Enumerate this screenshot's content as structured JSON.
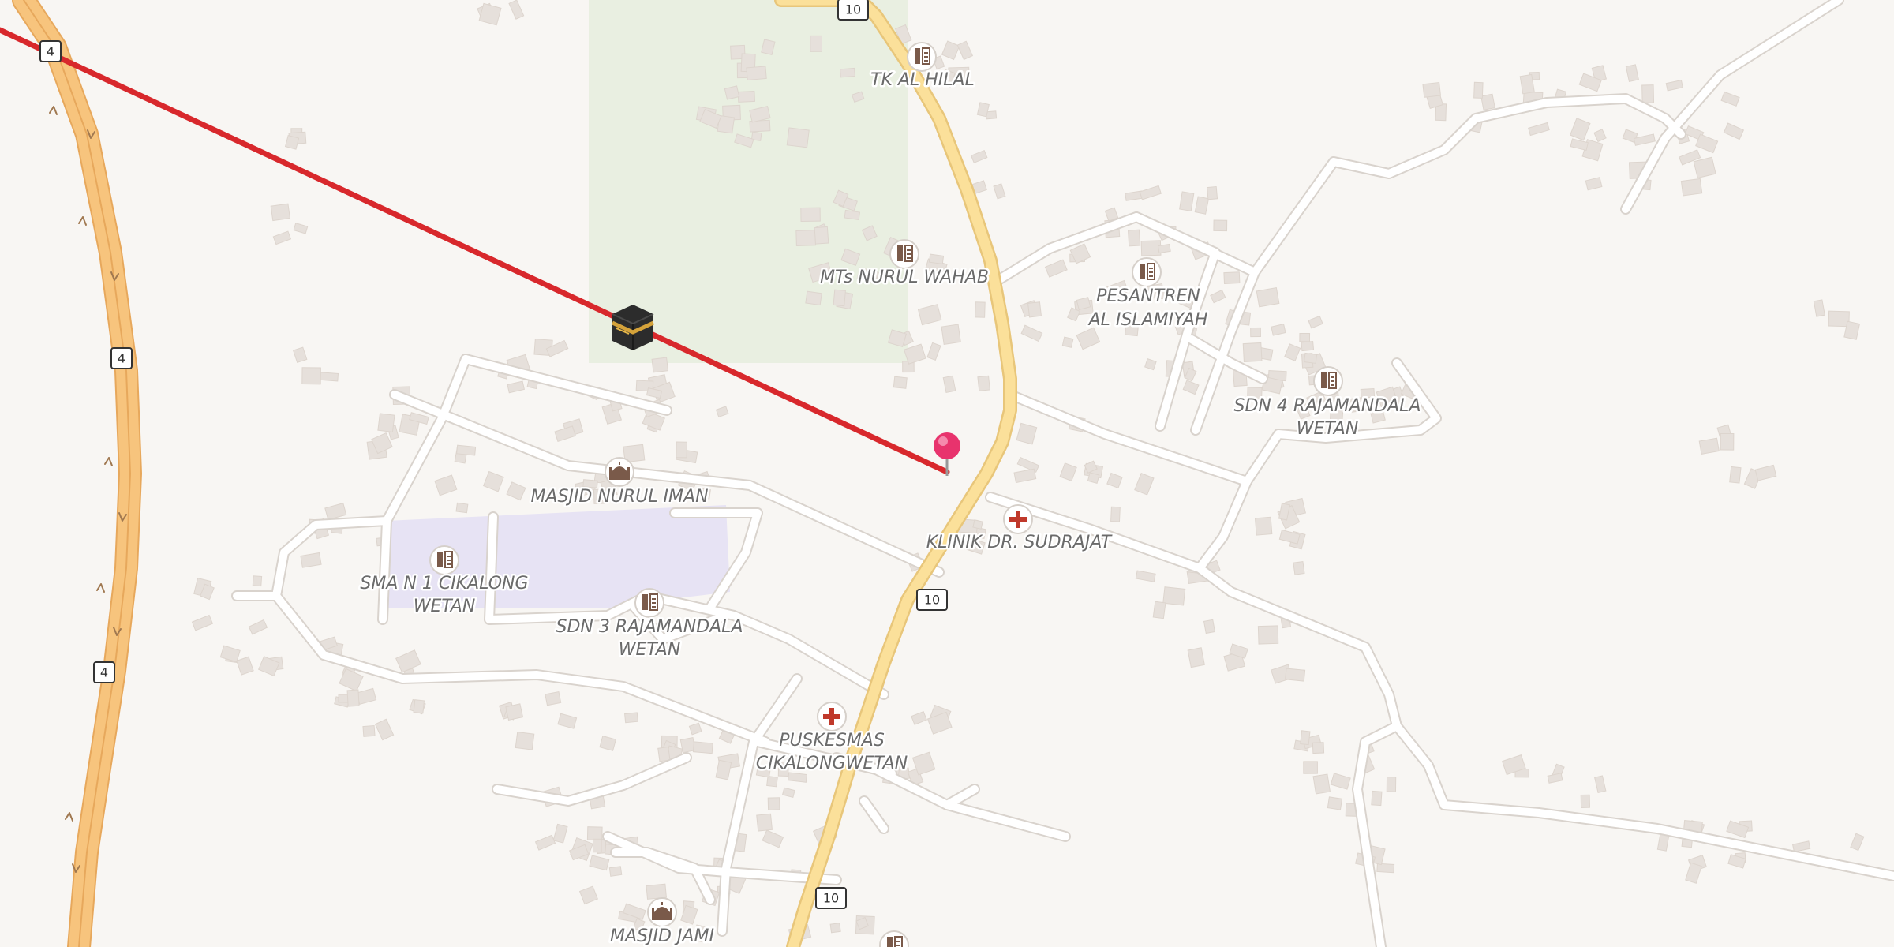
{
  "map": {
    "colors": {
      "background": "#f8f6f3",
      "park": "#e9efe1",
      "school": "#e7e3f4",
      "building": "#e6e0db",
      "road": "#ffffff",
      "main_road": "#fbe09a",
      "trunk_road": "#f7c47d",
      "qibla_line": "#d8282c",
      "pin": "#e8336d",
      "poi_icon": "#7a5a4a",
      "health_icon": "#c0392b"
    },
    "route_shields": [
      "4",
      "4",
      "4",
      "10",
      "10",
      "10"
    ],
    "poi_labels": [
      {
        "text": "TK AL HILAL",
        "icon": "school-icon"
      },
      {
        "text": "MTs NURUL WAHAB",
        "icon": "school-icon"
      },
      {
        "text": "PESANTREN",
        "icon": "school-icon"
      },
      {
        "text": "AL ISLAMIYAH",
        "icon": "none"
      },
      {
        "text": "SDN 4 RAJAMANDALA",
        "icon": "school-icon"
      },
      {
        "text": "WETAN",
        "icon": "none"
      },
      {
        "text": "MASJID NURUL IMAN",
        "icon": "mosque-icon"
      },
      {
        "text": "KLINIK DR. SUDRAJAT",
        "icon": "health-icon"
      },
      {
        "text": "SMA N 1 CIKALONG",
        "icon": "school-icon"
      },
      {
        "text": "WETAN",
        "icon": "none"
      },
      {
        "text": "SDN 3 RAJAMANDALA",
        "icon": "school-icon"
      },
      {
        "text": "WETAN",
        "icon": "none"
      },
      {
        "text": "PUSKESMAS",
        "icon": "health-icon"
      },
      {
        "text": "CIKALONGWETAN",
        "icon": "none"
      },
      {
        "text": "MASJID JAMI",
        "icon": "mosque-icon"
      }
    ],
    "markers": {
      "kaaba": "kaaba-icon",
      "location": "location-pin-icon"
    }
  }
}
